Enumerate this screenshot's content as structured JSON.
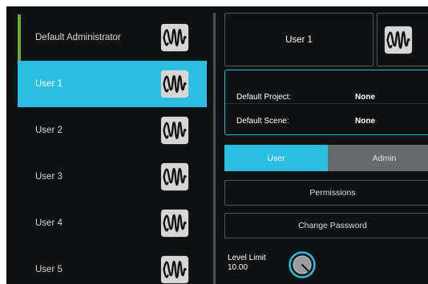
{
  "users": [
    {
      "label": "Default Administrator"
    },
    {
      "label": "User 1"
    },
    {
      "label": "User 2"
    },
    {
      "label": "User 3"
    },
    {
      "label": "User 4"
    },
    {
      "label": "User 5"
    }
  ],
  "selected_user_index": 1,
  "logo_icon": "presonus-logo-icon",
  "detail": {
    "user_name": "User 1",
    "default_project_label": "Default Project:",
    "default_project_value": "None",
    "default_scene_label": "Default Scene:",
    "default_scene_value": "None"
  },
  "role_toggle": {
    "user_label": "User",
    "admin_label": "Admin",
    "selected": "User"
  },
  "buttons": {
    "permissions": "Permissions",
    "change_password": "Change Password"
  },
  "level_limit": {
    "label": "Level Limit",
    "value": "10.00",
    "knob_icon": "rotary-knob-icon"
  },
  "colors": {
    "accent": "#2bbde3",
    "admin_indicator": "#63b037",
    "background": "#101112"
  }
}
